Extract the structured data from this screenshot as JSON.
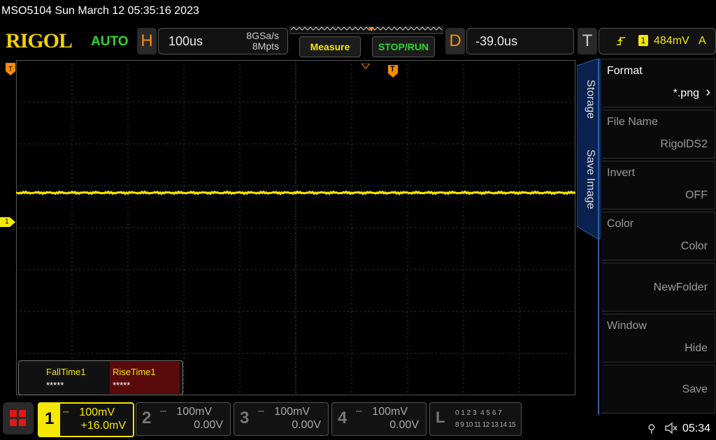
{
  "title_bar": {
    "text": "MSO5104  Sun March 12 05:35:16 2023"
  },
  "top": {
    "logo": "RIGOL",
    "mode": "AUTO",
    "horizontal": {
      "letter": "H",
      "timebase": "100us",
      "sample_rate": "8GSa/s",
      "memory_depth": "8Mpts"
    },
    "measure_label": "Measure",
    "stop_run_label": "STOP/RUN",
    "delay": {
      "letter": "D",
      "value": "-39.0us"
    },
    "trigger": {
      "letter": "T",
      "source": "1",
      "level": "484mV",
      "mode": "A"
    }
  },
  "waveform": {
    "channel_marker": "1",
    "trigger_marker": "T",
    "trace_color": "#f5e800"
  },
  "measurements": {
    "items": [
      {
        "name": "FallTime1",
        "value": "*****"
      },
      {
        "name": "RiseTime1",
        "value": "*****"
      }
    ]
  },
  "menu": {
    "tabs": [
      "Storage",
      "Save Image"
    ],
    "items": [
      {
        "label": "Format",
        "value": "*.png"
      },
      {
        "label": "File Name",
        "value": "RigolDS2"
      },
      {
        "label": "Invert",
        "value": "OFF"
      },
      {
        "label": "Color",
        "value": "Color"
      },
      {
        "label": "",
        "value": "NewFolder"
      },
      {
        "label": "Window",
        "value": "Hide"
      },
      {
        "label": "",
        "value": "Save"
      }
    ]
  },
  "channels": [
    {
      "num": "1",
      "scale": "100mV",
      "offset": "+16.0mV",
      "color": "#f5e800"
    },
    {
      "num": "2",
      "scale": "100mV",
      "offset": "0.00V"
    },
    {
      "num": "3",
      "scale": "100mV",
      "offset": "0.00V"
    },
    {
      "num": "4",
      "scale": "100mV",
      "offset": "0.00V"
    }
  ],
  "logic": {
    "letter": "L",
    "row1": "0 1 2 3  4 5 6 7",
    "row2": "8 9 10 11 12 13 14 15"
  },
  "status": {
    "clock": "05:34"
  }
}
